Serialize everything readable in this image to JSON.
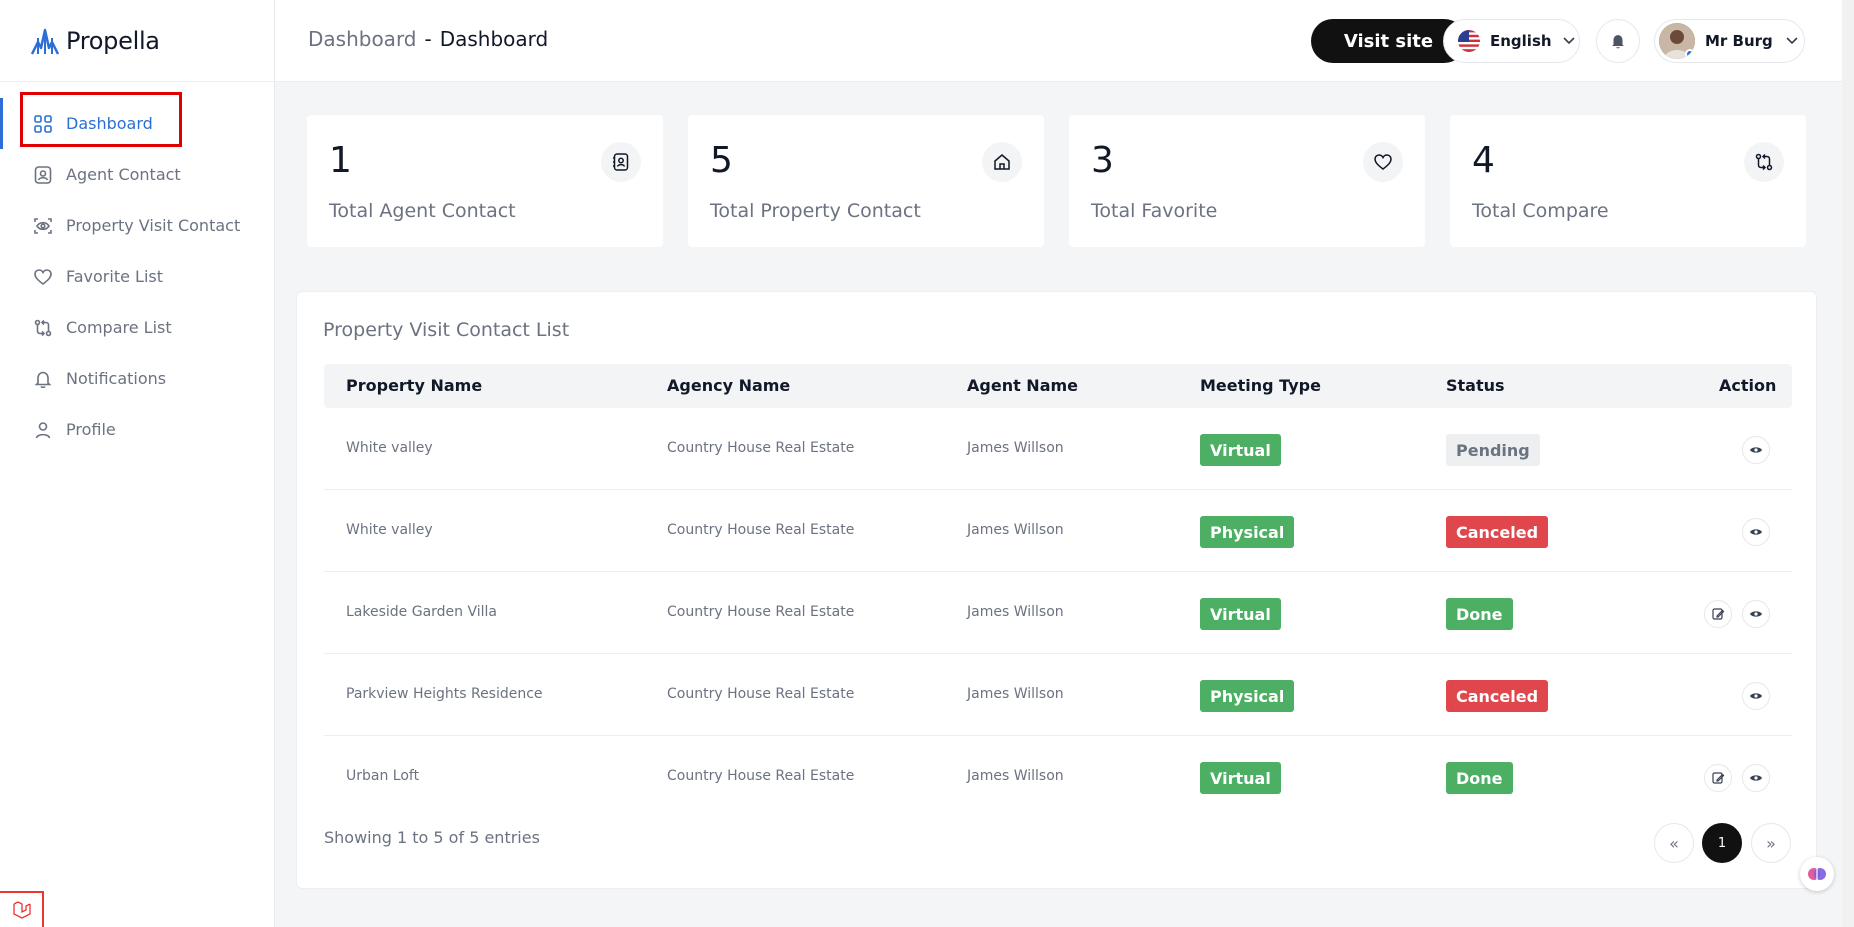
{
  "brand": {
    "name": "Propella"
  },
  "sidebar": {
    "items": [
      {
        "label": "Dashboard",
        "icon": "grid-icon",
        "active": true
      },
      {
        "label": "Agent Contact",
        "icon": "contact-card-icon"
      },
      {
        "label": "Property Visit Contact",
        "icon": "eye-scan-icon"
      },
      {
        "label": "Favorite List",
        "icon": "heart-icon"
      },
      {
        "label": "Compare List",
        "icon": "compare-icon"
      },
      {
        "label": "Notifications",
        "icon": "bell-icon"
      },
      {
        "label": "Profile",
        "icon": "user-icon"
      }
    ]
  },
  "header": {
    "breadcrumb": {
      "parent": "Dashboard",
      "separator": "-",
      "current": "Dashboard"
    },
    "visit_site": "Visit site",
    "language": "English",
    "user_name": "Mr Burg"
  },
  "stats": [
    {
      "value": "1",
      "label": "Total Agent Contact",
      "icon": "contact-book-icon"
    },
    {
      "value": "5",
      "label": "Total Property Contact",
      "icon": "home-icon"
    },
    {
      "value": "3",
      "label": "Total Favorite",
      "icon": "heart-icon"
    },
    {
      "value": "4",
      "label": "Total Compare",
      "icon": "compare-icon"
    }
  ],
  "table": {
    "title": "Property Visit Contact List",
    "columns": [
      "Property Name",
      "Agency Name",
      "Agent Name",
      "Meeting Type",
      "Status",
      "Action"
    ],
    "rows": [
      {
        "property": "White valley",
        "agency": "Country House Real Estate",
        "agent": "James Willson",
        "meeting": "Virtual",
        "status": "Pending"
      },
      {
        "property": "White valley",
        "agency": "Country House Real Estate",
        "agent": "James Willson",
        "meeting": "Physical",
        "status": "Canceled"
      },
      {
        "property": "Lakeside Garden Villa",
        "agency": "Country House Real Estate",
        "agent": "James Willson",
        "meeting": "Virtual",
        "status": "Done"
      },
      {
        "property": "Parkview Heights Residence",
        "agency": "Country House Real Estate",
        "agent": "James Willson",
        "meeting": "Physical",
        "status": "Canceled"
      },
      {
        "property": "Urban Loft",
        "agency": "Country House Real Estate",
        "agent": "James Willson",
        "meeting": "Virtual",
        "status": "Done"
      }
    ],
    "showing": "Showing 1 to 5 of 5 entries",
    "pagination": {
      "prev": "«",
      "current": "1",
      "next": "»"
    }
  },
  "colors": {
    "accent": "#2b6fd6",
    "success": "#4caf63",
    "danger": "#e0474c",
    "highlight": "#e10000"
  }
}
